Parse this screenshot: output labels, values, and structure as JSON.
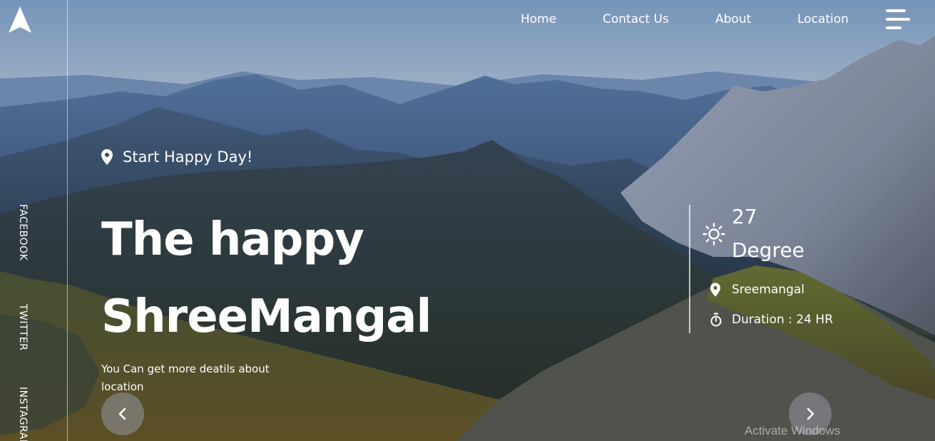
{
  "nav": {
    "home": "Home",
    "contact": "Contact Us",
    "about": "About",
    "location": "Location"
  },
  "social": {
    "facebook": "FACEBOOK",
    "twitter": "TWITTER",
    "instagram": "INSTAGRAM"
  },
  "hero": {
    "tagline": "Start Happy Day!",
    "headline_line1": "The happy",
    "headline_line2": "ShreeMangal",
    "subtext": "You Can get more deatils about location"
  },
  "weather": {
    "temperature": "27",
    "unit": "Degree",
    "place": "Sreemangal",
    "duration": "Duration : 24 HR"
  },
  "slider": {
    "prev_icon": "chevron-left-icon",
    "next_icon": "chevron-right-icon"
  },
  "watermark": "Activate Windows",
  "colors": {
    "text": "#ffffff",
    "arrow_bg": "#9696a0"
  }
}
